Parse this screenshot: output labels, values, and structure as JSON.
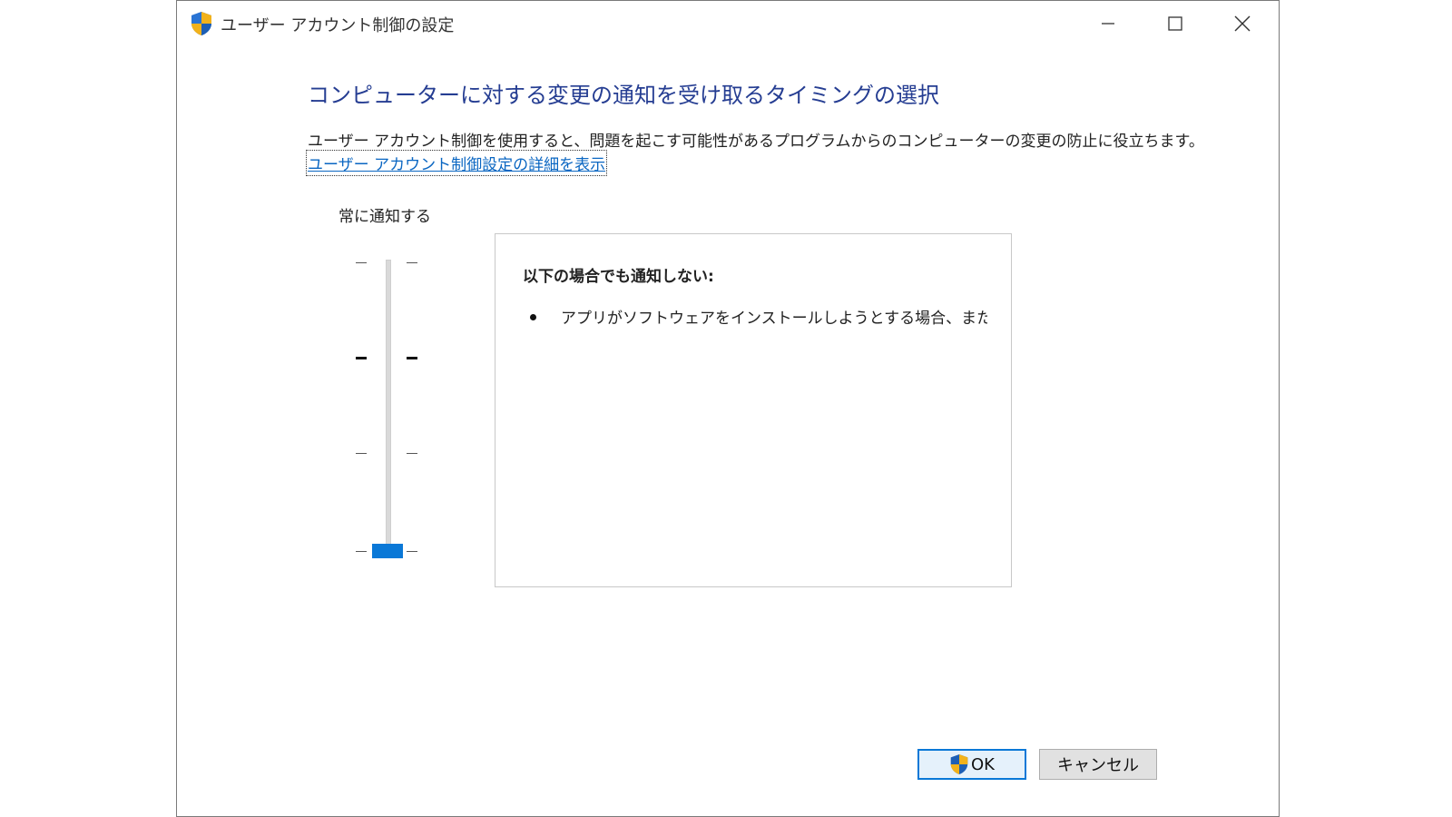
{
  "window": {
    "title": "ユーザー アカウント制御の設定",
    "icon": "uac-shield-icon"
  },
  "main": {
    "heading": "コンピューターに対する変更の通知を受け取るタイミングの選択",
    "description": "ユーザー アカウント制御を使用すると、問題を起こす可能性があるプログラムからのコンピューターの変更の防止に役立ちます。",
    "link": "ユーザー アカウント制御設定の詳細を表示"
  },
  "slider": {
    "top_label": "常に通知する",
    "levels": 4,
    "selected_level": 1,
    "accent_color": "#0a78d7"
  },
  "info": {
    "title": "以下の場合でも通知しない:",
    "items": [
      "アプリがソフトウェアをインストールしようとする場合、またはコン"
    ]
  },
  "buttons": {
    "ok": "OK",
    "cancel": "キャンセル"
  }
}
